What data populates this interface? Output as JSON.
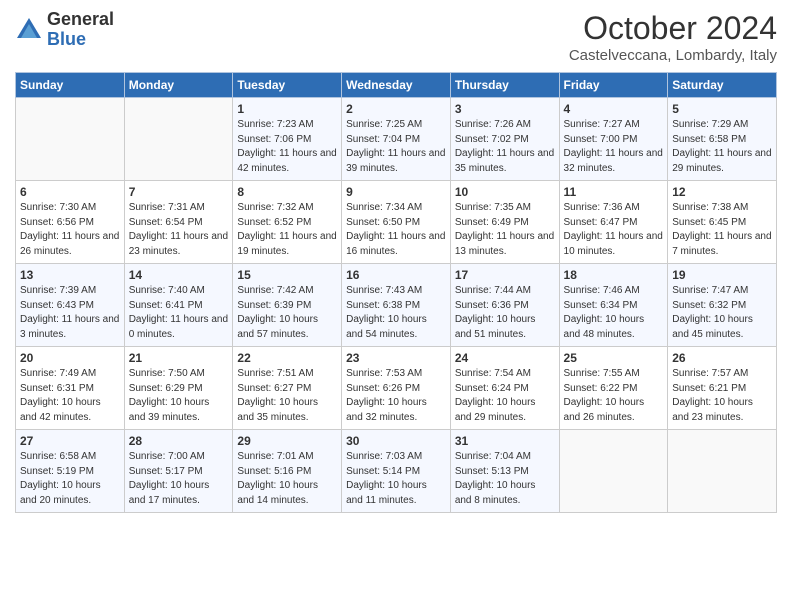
{
  "header": {
    "logo_general": "General",
    "logo_blue": "Blue",
    "month_title": "October 2024",
    "location": "Castelveccana, Lombardy, Italy"
  },
  "days_of_week": [
    "Sunday",
    "Monday",
    "Tuesday",
    "Wednesday",
    "Thursday",
    "Friday",
    "Saturday"
  ],
  "weeks": [
    [
      {
        "day": "",
        "info": ""
      },
      {
        "day": "",
        "info": ""
      },
      {
        "day": "1",
        "sunrise": "7:23 AM",
        "sunset": "7:06 PM",
        "daylight": "11 hours and 42 minutes."
      },
      {
        "day": "2",
        "sunrise": "7:25 AM",
        "sunset": "7:04 PM",
        "daylight": "11 hours and 39 minutes."
      },
      {
        "day": "3",
        "sunrise": "7:26 AM",
        "sunset": "7:02 PM",
        "daylight": "11 hours and 35 minutes."
      },
      {
        "day": "4",
        "sunrise": "7:27 AM",
        "sunset": "7:00 PM",
        "daylight": "11 hours and 32 minutes."
      },
      {
        "day": "5",
        "sunrise": "7:29 AM",
        "sunset": "6:58 PM",
        "daylight": "11 hours and 29 minutes."
      }
    ],
    [
      {
        "day": "6",
        "sunrise": "7:30 AM",
        "sunset": "6:56 PM",
        "daylight": "11 hours and 26 minutes."
      },
      {
        "day": "7",
        "sunrise": "7:31 AM",
        "sunset": "6:54 PM",
        "daylight": "11 hours and 23 minutes."
      },
      {
        "day": "8",
        "sunrise": "7:32 AM",
        "sunset": "6:52 PM",
        "daylight": "11 hours and 19 minutes."
      },
      {
        "day": "9",
        "sunrise": "7:34 AM",
        "sunset": "6:50 PM",
        "daylight": "11 hours and 16 minutes."
      },
      {
        "day": "10",
        "sunrise": "7:35 AM",
        "sunset": "6:49 PM",
        "daylight": "11 hours and 13 minutes."
      },
      {
        "day": "11",
        "sunrise": "7:36 AM",
        "sunset": "6:47 PM",
        "daylight": "11 hours and 10 minutes."
      },
      {
        "day": "12",
        "sunrise": "7:38 AM",
        "sunset": "6:45 PM",
        "daylight": "11 hours and 7 minutes."
      }
    ],
    [
      {
        "day": "13",
        "sunrise": "7:39 AM",
        "sunset": "6:43 PM",
        "daylight": "11 hours and 3 minutes."
      },
      {
        "day": "14",
        "sunrise": "7:40 AM",
        "sunset": "6:41 PM",
        "daylight": "11 hours and 0 minutes."
      },
      {
        "day": "15",
        "sunrise": "7:42 AM",
        "sunset": "6:39 PM",
        "daylight": "10 hours and 57 minutes."
      },
      {
        "day": "16",
        "sunrise": "7:43 AM",
        "sunset": "6:38 PM",
        "daylight": "10 hours and 54 minutes."
      },
      {
        "day": "17",
        "sunrise": "7:44 AM",
        "sunset": "6:36 PM",
        "daylight": "10 hours and 51 minutes."
      },
      {
        "day": "18",
        "sunrise": "7:46 AM",
        "sunset": "6:34 PM",
        "daylight": "10 hours and 48 minutes."
      },
      {
        "day": "19",
        "sunrise": "7:47 AM",
        "sunset": "6:32 PM",
        "daylight": "10 hours and 45 minutes."
      }
    ],
    [
      {
        "day": "20",
        "sunrise": "7:49 AM",
        "sunset": "6:31 PM",
        "daylight": "10 hours and 42 minutes."
      },
      {
        "day": "21",
        "sunrise": "7:50 AM",
        "sunset": "6:29 PM",
        "daylight": "10 hours and 39 minutes."
      },
      {
        "day": "22",
        "sunrise": "7:51 AM",
        "sunset": "6:27 PM",
        "daylight": "10 hours and 35 minutes."
      },
      {
        "day": "23",
        "sunrise": "7:53 AM",
        "sunset": "6:26 PM",
        "daylight": "10 hours and 32 minutes."
      },
      {
        "day": "24",
        "sunrise": "7:54 AM",
        "sunset": "6:24 PM",
        "daylight": "10 hours and 29 minutes."
      },
      {
        "day": "25",
        "sunrise": "7:55 AM",
        "sunset": "6:22 PM",
        "daylight": "10 hours and 26 minutes."
      },
      {
        "day": "26",
        "sunrise": "7:57 AM",
        "sunset": "6:21 PM",
        "daylight": "10 hours and 23 minutes."
      }
    ],
    [
      {
        "day": "27",
        "sunrise": "6:58 AM",
        "sunset": "5:19 PM",
        "daylight": "10 hours and 20 minutes."
      },
      {
        "day": "28",
        "sunrise": "7:00 AM",
        "sunset": "5:17 PM",
        "daylight": "10 hours and 17 minutes."
      },
      {
        "day": "29",
        "sunrise": "7:01 AM",
        "sunset": "5:16 PM",
        "daylight": "10 hours and 14 minutes."
      },
      {
        "day": "30",
        "sunrise": "7:03 AM",
        "sunset": "5:14 PM",
        "daylight": "10 hours and 11 minutes."
      },
      {
        "day": "31",
        "sunrise": "7:04 AM",
        "sunset": "5:13 PM",
        "daylight": "10 hours and 8 minutes."
      },
      {
        "day": "",
        "info": ""
      },
      {
        "day": "",
        "info": ""
      }
    ]
  ],
  "colors": {
    "header_bg": "#2e6db4",
    "odd_row": "#f5f8ff",
    "even_row": "#ffffff",
    "border": "#cccccc"
  }
}
